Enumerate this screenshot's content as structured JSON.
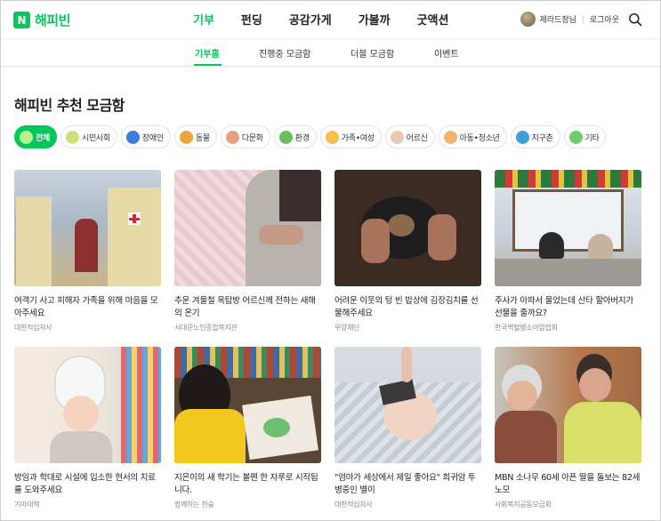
{
  "header": {
    "logo_badge": "N",
    "logo_text": "해피빈",
    "nav": [
      "기부",
      "펀딩",
      "공감가게",
      "가볼까",
      "굿액션"
    ],
    "user_name": "제라드정님",
    "logout": "로그아웃"
  },
  "subnav": [
    "기부홈",
    "진행중 모금함",
    "더블 모금함",
    "이벤트"
  ],
  "section_title": "해피빈 추천 모금함",
  "categories": [
    {
      "label": "전체",
      "icon": "leaf-icon",
      "color": "#7ed957"
    },
    {
      "label": "시민사회",
      "icon": "people-icon",
      "color": "#cfe07a"
    },
    {
      "label": "장애인",
      "icon": "wheelchair-icon",
      "color": "#3d7be0"
    },
    {
      "label": "동물",
      "icon": "cat-icon",
      "color": "#f2a23a"
    },
    {
      "label": "다문화",
      "icon": "handshake-icon",
      "color": "#e8a07c"
    },
    {
      "label": "환경",
      "icon": "sprout-icon",
      "color": "#6bbf59"
    },
    {
      "label": "가족•여성",
      "icon": "house-icon",
      "color": "#f3c146"
    },
    {
      "label": "어르신",
      "icon": "elder-icon",
      "color": "#e8c9b3"
    },
    {
      "label": "아동•청소년",
      "icon": "child-icon",
      "color": "#f4b36c"
    },
    {
      "label": "지구촌",
      "icon": "globe-icon",
      "color": "#3da0d8"
    },
    {
      "label": "기타",
      "icon": "dots-icon",
      "color": "#6ccf6c"
    }
  ],
  "cards": [
    {
      "title": "여객기 사고 피해자 가족을 위해 마음을 모아주세요",
      "org": "대한적십자사"
    },
    {
      "title": "추운 겨울철 옥탑방 어르신께 전하는 새해의 온기",
      "org": "서대문노인종합복지관"
    },
    {
      "title": "어려운 이웃의 텅 빈 밥상에 김장김치를 선물해주세요",
      "org": "우양재단"
    },
    {
      "title": "주사가 아파서 울었는데 산타 할아버지가 선물을 줄까요?",
      "org": "한국백혈병소아암협회"
    },
    {
      "title": "방임과 학대로 시설에 입소한 현서의 치료를 도와주세요",
      "org": "기아대책"
    },
    {
      "title": "지은이의 새 학기는 볼펜 한 자루로 시작됩니다.",
      "org": "함께하는 한숲"
    },
    {
      "title": "\"엄마가 세상에서 제일 좋아요\" 희귀암 투병중인 별이",
      "org": "대한적십자사"
    },
    {
      "title": "MBN 소나무 60세 아픈 딸을 돌보는 82세 노모",
      "org": "사회복지공동모금회"
    }
  ]
}
